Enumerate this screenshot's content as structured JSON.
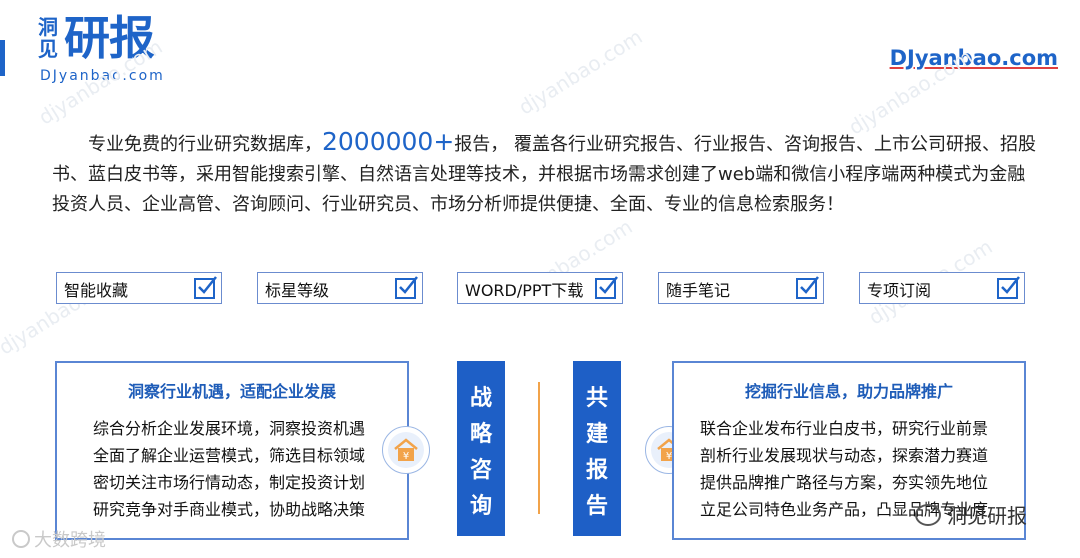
{
  "logo": {
    "small": "洞见",
    "big": "研报",
    "sub": "DJyanbao.com"
  },
  "site_url": "DJyanbao.com",
  "watermark": "djyanbao.com",
  "intro": {
    "pre": "专业免费的行业研究数据库，",
    "number": "2000000+",
    "post": "报告， 覆盖各行业研究报告、行业报告、咨询报告、上市公司研报、招股书、蓝白皮书等，采用智能搜索引擎、自然语言处理等技术，并根据市场需求创建了web端和微信小程序端两种模式为金融投资人员、企业高管、咨询顾问、行业研究员、市场分析师提供便捷、全面、专业的信息检索服务！"
  },
  "features": [
    "智能收藏",
    "标星等级",
    "WORD/PPT下载",
    "随手笔记",
    "专项订阅"
  ],
  "left_panel": {
    "title": "洞察行业机遇，适配企业发展",
    "lines": [
      "综合分析企业发展环境，洞察投资机遇",
      "全面了解企业运营模式，筛选目标领域",
      "密切关注市场行情动态，制定投资计划",
      "研究竞争对手商业模式，协助战略决策"
    ]
  },
  "center_left_label": "战略咨询",
  "center_right_label": "共建报告",
  "right_panel": {
    "title": "挖掘行业信息，助力品牌推广",
    "lines": [
      "联合企业发布行业白皮书，研究行业前景",
      "剖析行业发展现状与动态，探索潜力赛道",
      "提供品牌推广路径与方案，夯实领先地位",
      "立足公司特色业务产品，凸显品牌专业度"
    ]
  },
  "footer_left": "大数跨境",
  "footer_right": "洞见研报",
  "colors": {
    "brand_blue": "#1e64c8",
    "orange": "#f2a34a"
  }
}
